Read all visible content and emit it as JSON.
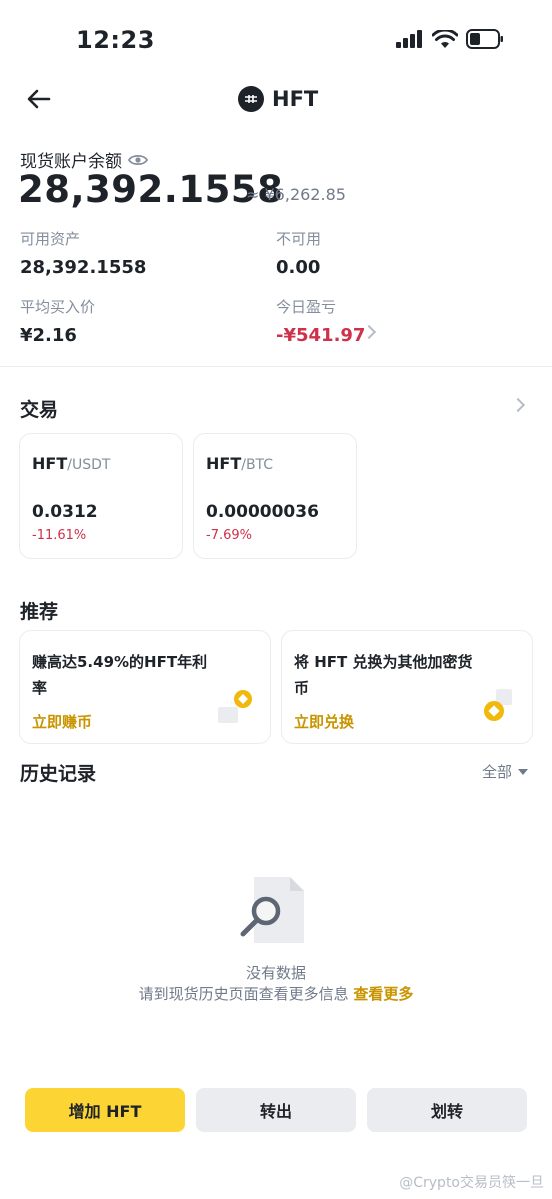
{
  "status_bar": {
    "time": "12:23"
  },
  "header": {
    "coin": "HFT",
    "logo_icon": "hft-logo-icon"
  },
  "balance": {
    "label": "现货账户余额",
    "amount": "28,392.1558",
    "fiat": "≈ ¥6,262.85"
  },
  "details": {
    "available_label": "可用资产",
    "available_value": "28,392.1558",
    "unavailable_label": "不可用",
    "unavailable_value": "0.00",
    "avg_price_label": "平均买入价",
    "avg_price_value": "¥2.16",
    "today_pnl_label": "今日盈亏",
    "today_pnl_value": "-¥541.97"
  },
  "trade": {
    "title": "交易",
    "pairs": [
      {
        "base": "HFT",
        "quote": "/USDT",
        "price": "0.0312",
        "change": "-11.61%"
      },
      {
        "base": "HFT",
        "quote": "/BTC",
        "price": "0.00000036",
        "change": "-7.69%"
      }
    ]
  },
  "recommend": {
    "title": "推荐",
    "cards": [
      {
        "text": "赚高达5.49%的HFT年利率",
        "cta": "立即赚币"
      },
      {
        "text": "将 HFT 兑换为其他加密货币",
        "cta": "立即兑换"
      }
    ]
  },
  "history": {
    "title": "历史记录",
    "filter": "全部",
    "empty_title": "没有数据",
    "empty_desc": "请到现货历史页面查看更多信息",
    "empty_link": "查看更多"
  },
  "actions": {
    "deposit": "增加 HFT",
    "withdraw": "转出",
    "transfer": "划转"
  },
  "watermark": "@Crypto交易员筷一旦",
  "colors": {
    "accent": "#fcd535",
    "negative": "#cf304a",
    "link": "#c99400"
  }
}
